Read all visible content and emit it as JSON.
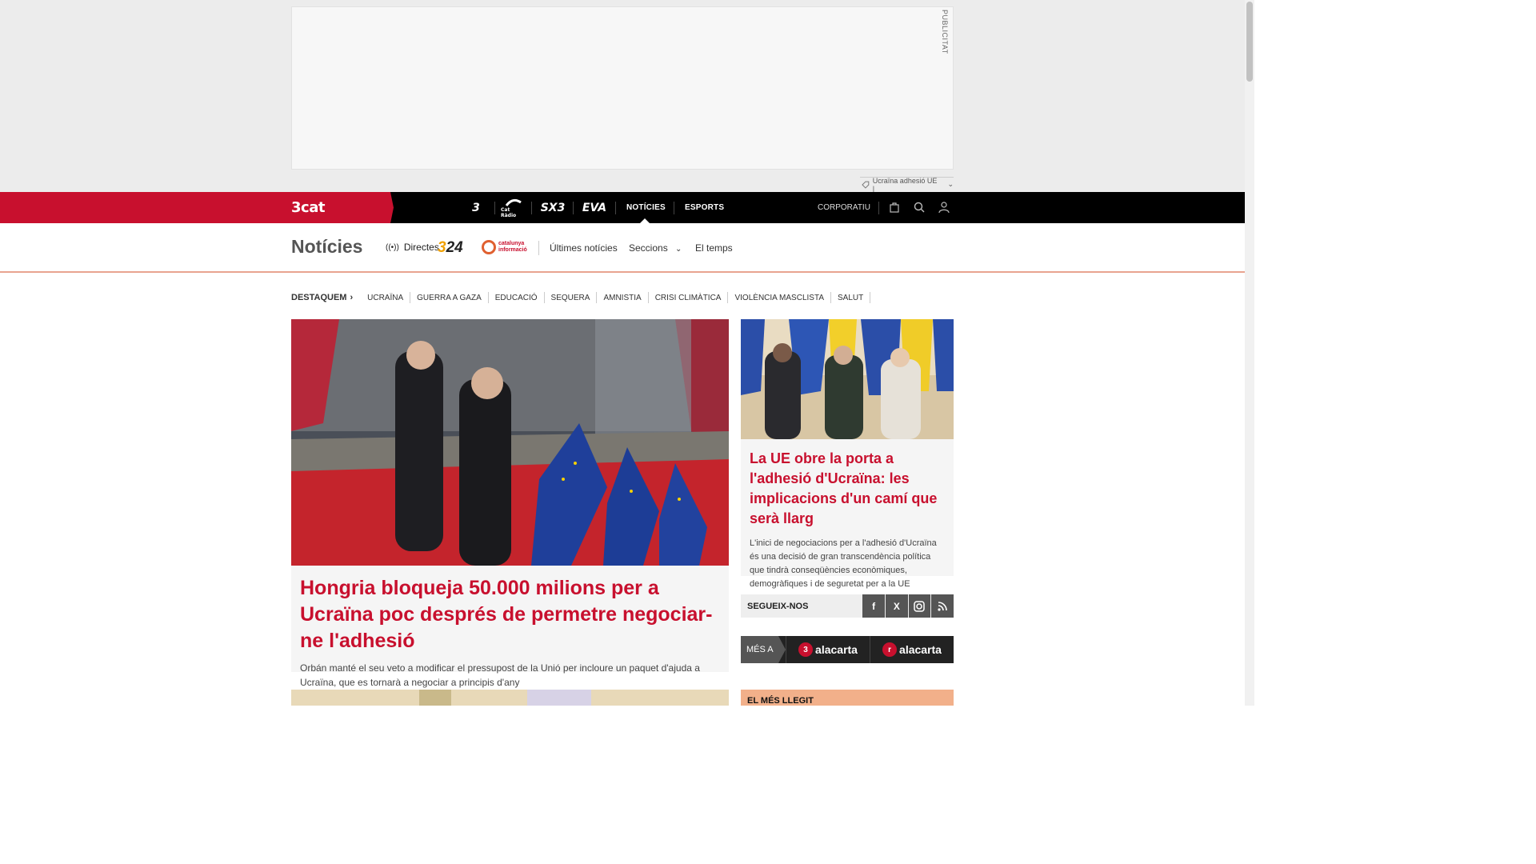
{
  "ad": {
    "label": "PUBLICITAT",
    "tag": "Ucraïna adhesió UE |"
  },
  "topnav": {
    "brand": "3cat",
    "channels": [
      "3",
      "Cat Ràdio",
      "SX3",
      "EVA"
    ],
    "links": [
      "NOTÍCIES",
      "ESPORTS"
    ],
    "corporate": "CORPORATIU"
  },
  "subnav": {
    "title": "Notícies",
    "directes": "Directes",
    "logo_324": "324",
    "logo_cat": "catalunya informació",
    "links": [
      "Últimes notícies",
      "Seccions",
      "El temps"
    ]
  },
  "highlights": {
    "lead": "DESTAQUEM",
    "items": [
      "UCRAÏNA",
      "GUERRA A GAZA",
      "EDUCACIÓ",
      "SEQUERA",
      "AMNISTIA",
      "CRISI CLIMÀTICA",
      "VIOLÈNCIA MASCLISTA",
      "SALUT"
    ]
  },
  "main_article": {
    "title": "Hongria bloqueja 50.000 milions per a Ucraïna poc després de permetre negociar-ne l'adhesió",
    "summary": "Orbán manté el seu veto a modificar el pressupost de la Unió per incloure un paquet d'ajuda a Ucraïna, que es tornarà a negociar a principis d'any"
  },
  "side_article": {
    "title": "La UE obre la porta a l'adhesió d'Ucraïna: les implicacions d'un camí que serà llarg",
    "summary": "L'inici de negociacions per a l'adhesió d'Ucraïna és una decisió de gran transcendència política que tindrà conseqüències econòmiques, demogràfiques i de seguretat per a la UE"
  },
  "follow": {
    "label": "SEGUEIX-NOS",
    "networks": [
      "facebook",
      "x",
      "instagram",
      "rss"
    ]
  },
  "alacarta": {
    "prefix": "MÉS A",
    "items": [
      "alacarta",
      "alacarta"
    ],
    "badges": [
      "3",
      "r"
    ]
  },
  "most_read": {
    "label": "EL MÉS LLEGIT"
  },
  "colors": {
    "brand": "#c8102e",
    "nav": "#000000"
  }
}
